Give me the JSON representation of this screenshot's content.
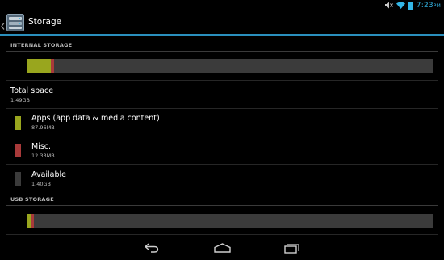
{
  "status": {
    "time": "7:23",
    "ampm": "PM",
    "icons": [
      "volume-muted-icon",
      "wifi-icon",
      "battery-icon"
    ]
  },
  "actionbar": {
    "title": "Storage",
    "icon": "storage-settings-icon"
  },
  "internal": {
    "header": "INTERNAL STORAGE",
    "usage_fractions": {
      "apps": 0.059,
      "misc": 0.008,
      "available": 0.933
    },
    "total": {
      "label": "Total space",
      "value": "1.49GB"
    },
    "items": [
      {
        "label": "Apps (app data & media content)",
        "value": "87.96MB",
        "color": "#99a61e"
      },
      {
        "label": "Misc.",
        "value": "12.33MB",
        "color": "#a83a3a"
      },
      {
        "label": "Available",
        "value": "1.40GB",
        "color": "#3b3b3b"
      }
    ]
  },
  "usb": {
    "header": "USB STORAGE",
    "usage_fractions": {
      "apps": 0.012,
      "misc": 0.006,
      "available": 0.982
    }
  },
  "colors": {
    "accent": "#33b5e5",
    "apps": "#99a61e",
    "misc": "#a83a3a",
    "available": "#3b3b3b"
  },
  "navbar": {
    "icons": [
      "back-icon",
      "home-icon",
      "recent-apps-icon"
    ]
  }
}
